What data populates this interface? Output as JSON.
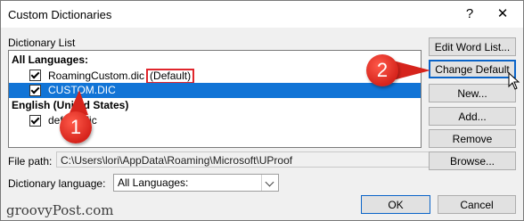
{
  "window": {
    "title": "Custom Dictionaries",
    "help_glyph": "?",
    "close_glyph": "✕"
  },
  "list": {
    "label": "Dictionary List",
    "groups": [
      {
        "header": "All Languages:"
      },
      {
        "header": "English (United States)"
      }
    ],
    "items": [
      {
        "name": "RoamingCustom.dic",
        "tag": "(Default)",
        "checked": true,
        "selected": false
      },
      {
        "name": "CUSTOM.DIC",
        "checked": true,
        "selected": true
      },
      {
        "name": "default.dic",
        "checked": true,
        "selected": false
      }
    ]
  },
  "buttons": {
    "edit_word_list": "Edit Word List...",
    "change_default": "Change Default",
    "new": "New...",
    "add": "Add...",
    "remove": "Remove",
    "browse": "Browse...",
    "ok": "OK",
    "cancel": "Cancel"
  },
  "file_path": {
    "label": "File path:",
    "value": "C:\\Users\\lori\\AppData\\Roaming\\Microsoft\\UProof"
  },
  "dictionary_language": {
    "label": "Dictionary language:",
    "value": "All Languages:"
  },
  "annotations": {
    "step1": "1",
    "step2": "2"
  },
  "watermark": "groovyPost.com",
  "colors": {
    "selection": "#1174d6",
    "highlight_box": "#e0262c",
    "badge": "#d6241c"
  }
}
